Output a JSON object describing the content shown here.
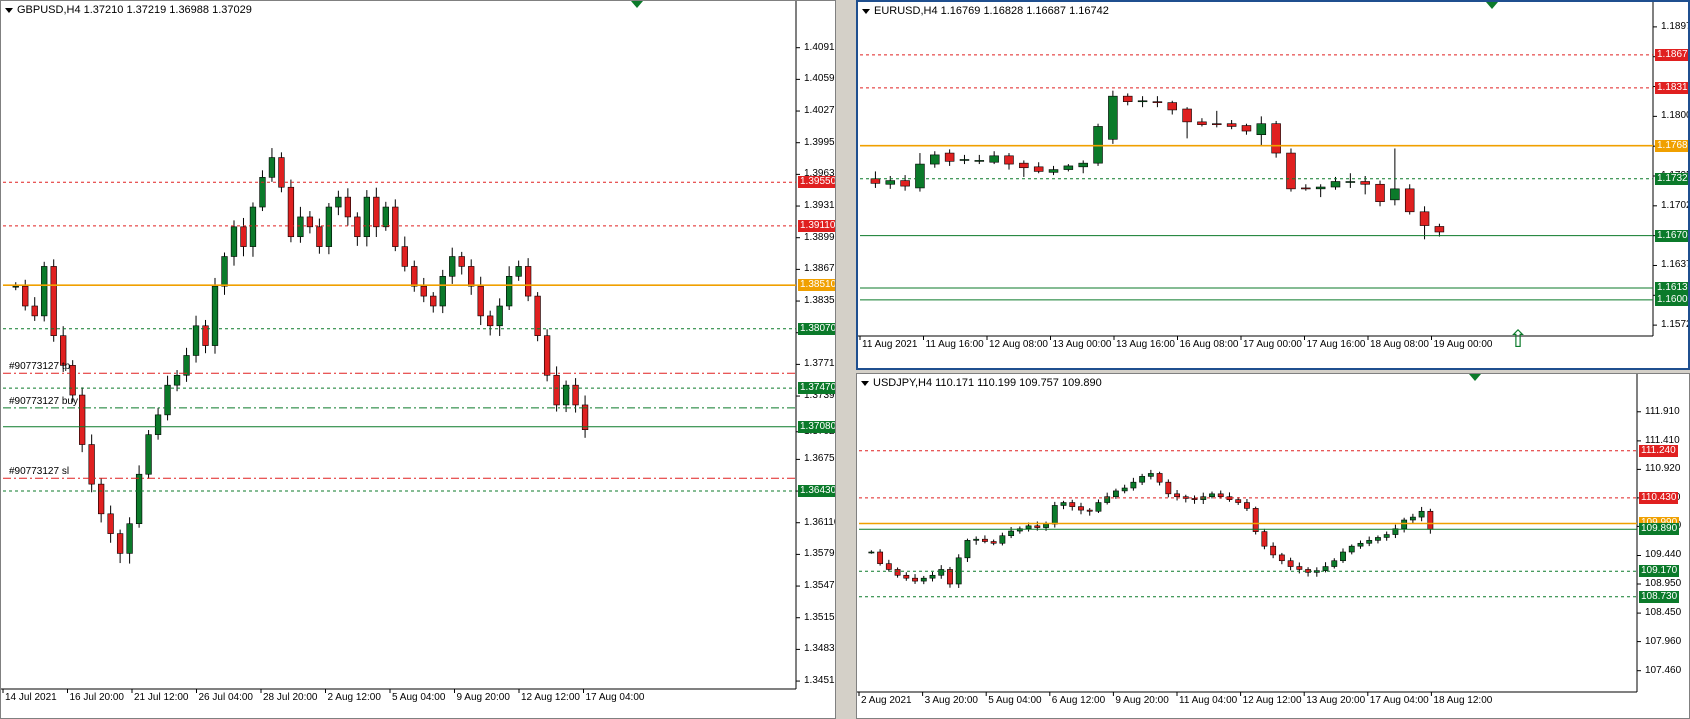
{
  "charts": [
    {
      "id": "gbpusd",
      "title": "GBPUSD,H4  1.37210 1.37219 1.36988 1.37029",
      "y_ticks": [
        "1.40910",
        "1.40590",
        "1.40270",
        "1.39950",
        "1.39630",
        "1.39310",
        "1.38990",
        "1.38670",
        "1.38350",
        "1.38030",
        "1.37710",
        "1.37390",
        "1.37029",
        "1.36750",
        "1.36430",
        "1.36110",
        "1.35790",
        "1.35470",
        "1.35150",
        "1.34830",
        "1.34510"
      ],
      "x_ticks": [
        "14 Jul 2021",
        "16 Jul 20:00",
        "21 Jul 12:00",
        "26 Jul 04:00",
        "28 Jul 20:00",
        "2 Aug 12:00",
        "5 Aug 04:00",
        "9 Aug 20:00",
        "12 Aug 12:00",
        "17 Aug 04:00"
      ],
      "order_labels": [
        "#90773127 tp",
        "#90773127 buy",
        "#90773127 sl"
      ],
      "levels": [
        {
          "value": "1.39550",
          "style": "dotted",
          "color": "#e02020"
        },
        {
          "value": "1.39110",
          "style": "dotted",
          "color": "#e02020"
        },
        {
          "value": "1.38510",
          "style": "solid",
          "color": "#f0a000"
        },
        {
          "value": "1.38070",
          "style": "dotted",
          "color": "#0b7a2a"
        },
        {
          "value": "1.37470",
          "style": "dotted",
          "color": "#0b7a2a"
        },
        {
          "value": "1.37080",
          "style": "solid",
          "color": "#0b7a2a"
        },
        {
          "value": "1.36430",
          "style": "dotted",
          "color": "#0b7a2a"
        }
      ]
    },
    {
      "id": "eurusd",
      "title": "EURUSD,H4  1.16769 1.16828 1.16687 1.16742",
      "y_ticks": [
        "1.18975",
        "1.18650",
        "1.18325",
        "1.18000",
        "1.17675",
        "1.17350",
        "1.17025",
        "1.16700",
        "1.16375",
        "1.16050",
        "1.15725"
      ],
      "x_ticks": [
        "11 Aug 2021",
        "11 Aug 16:00",
        "12 Aug 08:00",
        "13 Aug 00:00",
        "13 Aug 16:00",
        "16 Aug 08:00",
        "17 Aug 00:00",
        "17 Aug 16:00",
        "18 Aug 08:00",
        "19 Aug 00:00"
      ],
      "levels": [
        {
          "value": "1.18670",
          "style": "dotted",
          "color": "#e02020"
        },
        {
          "value": "1.18310",
          "style": "dotted",
          "color": "#e02020"
        },
        {
          "value": "1.17680",
          "style": "solid",
          "color": "#f0a000"
        },
        {
          "value": "1.17320",
          "style": "dotted",
          "color": "#0b7a2a"
        },
        {
          "value": "1.16700",
          "style": "solid",
          "color": "#0b7a2a"
        },
        {
          "value": "1.16130",
          "style": "solid",
          "color": "#0b7a2a"
        },
        {
          "value": "1.16000",
          "style": "solid",
          "color": "#0b7a2a"
        }
      ]
    },
    {
      "id": "usdjpy",
      "title": "USDJPY,H4  110.171 110.199 109.757 109.890",
      "y_ticks": [
        "111.910",
        "111.410",
        "110.920",
        "110.430",
        "109.940",
        "109.440",
        "108.950",
        "108.450",
        "107.960",
        "107.460"
      ],
      "x_ticks": [
        "2 Aug 2021",
        "3 Aug 20:00",
        "5 Aug 04:00",
        "6 Aug 12:00",
        "9 Aug 20:00",
        "11 Aug 04:00",
        "12 Aug 12:00",
        "13 Aug 20:00",
        "17 Aug 04:00",
        "18 Aug 12:00"
      ],
      "levels": [
        {
          "value": "111.240",
          "style": "dotted",
          "color": "#e02020"
        },
        {
          "value": "110.430",
          "style": "dotted",
          "color": "#e02020"
        },
        {
          "value": "109.990",
          "style": "solid",
          "color": "#f0a000"
        },
        {
          "value": "109.890",
          "style": "solid",
          "color": "#0b7a2a"
        },
        {
          "value": "109.170",
          "style": "dotted",
          "color": "#0b7a2a"
        },
        {
          "value": "108.730",
          "style": "dotted",
          "color": "#0b7a2a"
        }
      ]
    }
  ],
  "chart_data": [
    {
      "type": "candlestick",
      "title": "GBPUSD,H4",
      "ylim": [
        1.3445,
        1.412
      ],
      "bull_color": "#0b7a2a",
      "bear_color": "#e02020",
      "close_path": [
        1.385,
        1.383,
        1.382,
        1.387,
        1.38,
        1.377,
        1.374,
        1.369,
        1.365,
        1.362,
        1.36,
        1.358,
        1.361,
        1.366,
        1.37,
        1.372,
        1.375,
        1.376,
        1.378,
        1.381,
        1.379,
        1.385,
        1.388,
        1.391,
        1.389,
        1.393,
        1.396,
        1.398,
        1.395,
        1.39,
        1.392,
        1.391,
        1.389,
        1.393,
        1.394,
        1.392,
        1.39,
        1.394,
        1.391,
        1.393,
        1.389,
        1.387,
        1.385,
        1.384,
        1.383,
        1.386,
        1.388,
        1.387,
        1.385,
        1.382,
        1.381,
        1.383,
        1.386,
        1.387,
        1.384,
        1.38,
        1.376,
        1.373,
        1.375,
        1.373,
        1.3705
      ]
    },
    {
      "type": "candlestick",
      "title": "EURUSD,H4",
      "ylim": [
        1.1565,
        1.1905
      ],
      "bull_color": "#0b7a2a",
      "bear_color": "#e02020",
      "candles": [
        {
          "o": 1.1732,
          "h": 1.174,
          "l": 1.1722,
          "c": 1.1727
        },
        {
          "o": 1.1726,
          "h": 1.1735,
          "l": 1.1721,
          "c": 1.173
        },
        {
          "o": 1.173,
          "h": 1.1736,
          "l": 1.1719,
          "c": 1.1724
        },
        {
          "o": 1.1722,
          "h": 1.176,
          "l": 1.1718,
          "c": 1.1748
        },
        {
          "o": 1.1748,
          "h": 1.1762,
          "l": 1.1744,
          "c": 1.1758
        },
        {
          "o": 1.176,
          "h": 1.1764,
          "l": 1.1746,
          "c": 1.1751
        },
        {
          "o": 1.1752,
          "h": 1.1758,
          "l": 1.1748,
          "c": 1.1753
        },
        {
          "o": 1.1752,
          "h": 1.1758,
          "l": 1.1748,
          "c": 1.1752
        },
        {
          "o": 1.175,
          "h": 1.1762,
          "l": 1.1748,
          "c": 1.1757
        },
        {
          "o": 1.1757,
          "h": 1.176,
          "l": 1.1742,
          "c": 1.1748
        },
        {
          "o": 1.1749,
          "h": 1.1752,
          "l": 1.1734,
          "c": 1.1744
        },
        {
          "o": 1.1745,
          "h": 1.175,
          "l": 1.1738,
          "c": 1.174
        },
        {
          "o": 1.1739,
          "h": 1.1746,
          "l": 1.1736,
          "c": 1.1742
        },
        {
          "o": 1.1742,
          "h": 1.1748,
          "l": 1.174,
          "c": 1.1746
        },
        {
          "o": 1.1745,
          "h": 1.1752,
          "l": 1.1738,
          "c": 1.1749
        },
        {
          "o": 1.1749,
          "h": 1.1792,
          "l": 1.1746,
          "c": 1.1789
        },
        {
          "o": 1.1775,
          "h": 1.1828,
          "l": 1.177,
          "c": 1.1822
        },
        {
          "o": 1.1822,
          "h": 1.1825,
          "l": 1.1812,
          "c": 1.1816
        },
        {
          "o": 1.1816,
          "h": 1.1822,
          "l": 1.181,
          "c": 1.1817
        },
        {
          "o": 1.1816,
          "h": 1.1822,
          "l": 1.181,
          "c": 1.1815
        },
        {
          "o": 1.1815,
          "h": 1.1817,
          "l": 1.1802,
          "c": 1.1807
        },
        {
          "o": 1.1808,
          "h": 1.181,
          "l": 1.1776,
          "c": 1.1794
        },
        {
          "o": 1.1794,
          "h": 1.1798,
          "l": 1.1789,
          "c": 1.1791
        },
        {
          "o": 1.1792,
          "h": 1.1806,
          "l": 1.1788,
          "c": 1.1791
        },
        {
          "o": 1.1792,
          "h": 1.1796,
          "l": 1.1786,
          "c": 1.1789
        },
        {
          "o": 1.179,
          "h": 1.1792,
          "l": 1.178,
          "c": 1.1784
        },
        {
          "o": 1.178,
          "h": 1.18,
          "l": 1.1768,
          "c": 1.1792
        },
        {
          "o": 1.1792,
          "h": 1.1795,
          "l": 1.1755,
          "c": 1.176
        },
        {
          "o": 1.176,
          "h": 1.1765,
          "l": 1.1718,
          "c": 1.1721
        },
        {
          "o": 1.1722,
          "h": 1.1726,
          "l": 1.1719,
          "c": 1.1721
        },
        {
          "o": 1.1721,
          "h": 1.1726,
          "l": 1.1712,
          "c": 1.1723
        },
        {
          "o": 1.1723,
          "h": 1.1734,
          "l": 1.172,
          "c": 1.1729
        },
        {
          "o": 1.1729,
          "h": 1.1738,
          "l": 1.1722,
          "c": 1.1729
        },
        {
          "o": 1.1729,
          "h": 1.1735,
          "l": 1.1715,
          "c": 1.1726
        },
        {
          "o": 1.1726,
          "h": 1.173,
          "l": 1.1702,
          "c": 1.1707
        },
        {
          "o": 1.1709,
          "h": 1.1765,
          "l": 1.1703,
          "c": 1.1721
        },
        {
          "o": 1.1721,
          "h": 1.1726,
          "l": 1.1693,
          "c": 1.1696
        },
        {
          "o": 1.1696,
          "h": 1.1702,
          "l": 1.1666,
          "c": 1.1681
        },
        {
          "o": 1.168,
          "h": 1.1683,
          "l": 1.1669,
          "c": 1.1674
        }
      ]
    },
    {
      "type": "candlestick",
      "title": "USDJPY,H4",
      "ylim": [
        107.3,
        112.25
      ],
      "bull_color": "#0b7a2a",
      "bear_color": "#e02020",
      "close_path": [
        109.5,
        109.3,
        109.2,
        109.1,
        109.05,
        109.0,
        109.05,
        109.1,
        109.2,
        108.95,
        109.4,
        109.7,
        109.72,
        109.68,
        109.65,
        109.78,
        109.86,
        109.9,
        109.95,
        109.92,
        109.98,
        110.3,
        110.35,
        110.28,
        110.22,
        110.2,
        110.35,
        110.45,
        110.55,
        110.6,
        110.7,
        110.8,
        110.85,
        110.7,
        110.5,
        110.45,
        110.42,
        110.4,
        110.45,
        110.5,
        110.45,
        110.4,
        110.35,
        110.25,
        109.85,
        109.6,
        109.45,
        109.35,
        109.25,
        109.2,
        109.15,
        109.18,
        109.25,
        109.35,
        109.5,
        109.6,
        109.65,
        109.7,
        109.75,
        109.8,
        109.9,
        110.05,
        110.1,
        110.2,
        109.89
      ]
    }
  ]
}
